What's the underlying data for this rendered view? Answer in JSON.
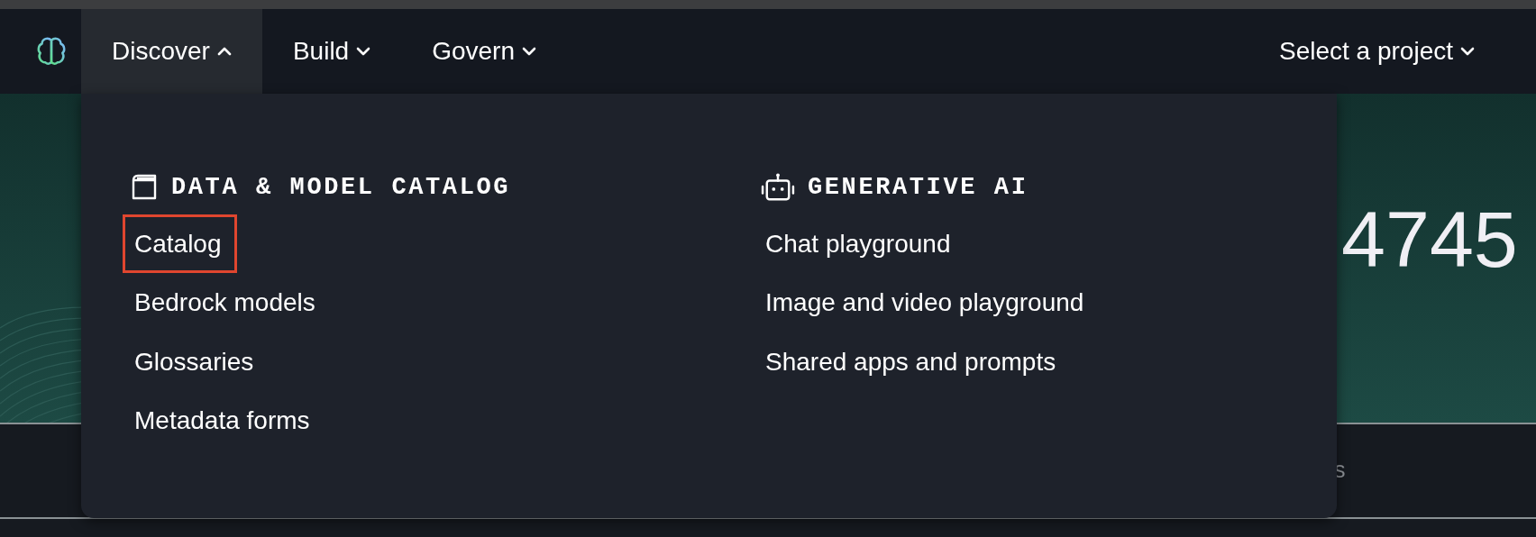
{
  "nav": {
    "tabs": [
      {
        "label": "Discover",
        "expanded": true
      },
      {
        "label": "Build",
        "expanded": false
      },
      {
        "label": "Govern",
        "expanded": false
      }
    ],
    "project_selector": {
      "label": "Select a project",
      "expanded": false
    }
  },
  "banner": {
    "heading": "4745"
  },
  "below_banner": {
    "text": "s"
  },
  "dropdown": {
    "sections": [
      {
        "kind": "catalog",
        "title": "DATA & MODEL CATALOG",
        "items": [
          {
            "label": "Catalog",
            "highlighted": true
          },
          {
            "label": "Bedrock models",
            "highlighted": false
          },
          {
            "label": "Glossaries",
            "highlighted": false
          },
          {
            "label": "Metadata forms",
            "highlighted": false
          }
        ]
      },
      {
        "kind": "ai",
        "title": "GENERATIVE AI",
        "items": [
          {
            "label": "Chat playground",
            "highlighted": false
          },
          {
            "label": "Image and video playground",
            "highlighted": false
          },
          {
            "label": "Shared apps and prompts",
            "highlighted": false
          }
        ]
      }
    ]
  }
}
